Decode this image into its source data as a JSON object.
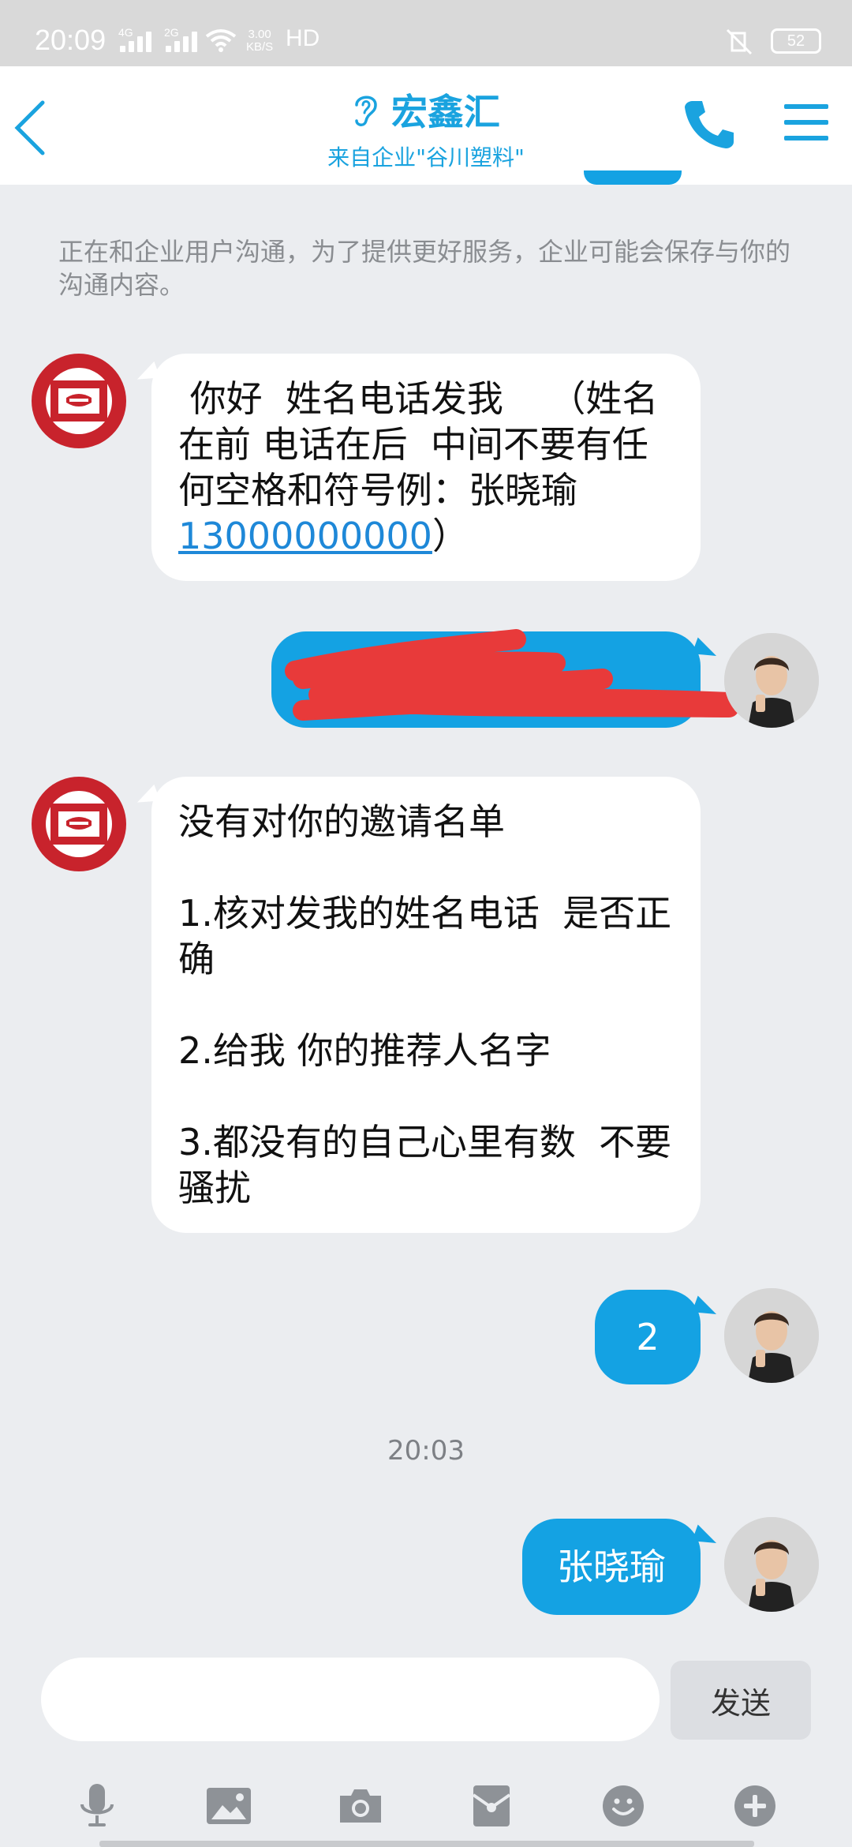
{
  "status_bar": {
    "time": "20:09",
    "net1": "4G",
    "net2": "2G",
    "speed_value": "3.00",
    "speed_unit": "KB/S",
    "hd": "HD",
    "battery": "52"
  },
  "header": {
    "title": "宏鑫汇",
    "subtitle": "来自企业\"谷川塑料\""
  },
  "notice": "正在和企业用户沟通，为了提供更好服务，企业可能会保存与你的沟通内容。",
  "messages": {
    "m1": {
      "text_before_link": " 你好  姓名电话发我    （姓名在前 电话在后  中间不要有任何空格和符号例：张晓瑜",
      "link": "13000000000",
      "text_after_link": "）"
    },
    "m3": {
      "text": "没有对你的邀请名单\n\n1.核对发我的姓名电话  是否正确\n\n2.给我 你的推荐人名字\n\n3.都没有的自己心里有数  不要骚扰"
    },
    "m4": {
      "text": "2"
    },
    "time_divider": "20:03",
    "m5": {
      "text": "张晓瑜"
    }
  },
  "input": {
    "value": "",
    "placeholder": "",
    "send_label": "发送"
  },
  "toolbar_icons": [
    "microphone-icon",
    "image-icon",
    "camera-icon",
    "red-packet-icon",
    "emoji-icon",
    "plus-icon"
  ],
  "colors": {
    "accent": "#1aa3df",
    "outgoing_bubble": "#14a2e3",
    "background": "#ebedf0",
    "logo_red": "#c8232c",
    "redaction": "#e83a3a"
  }
}
